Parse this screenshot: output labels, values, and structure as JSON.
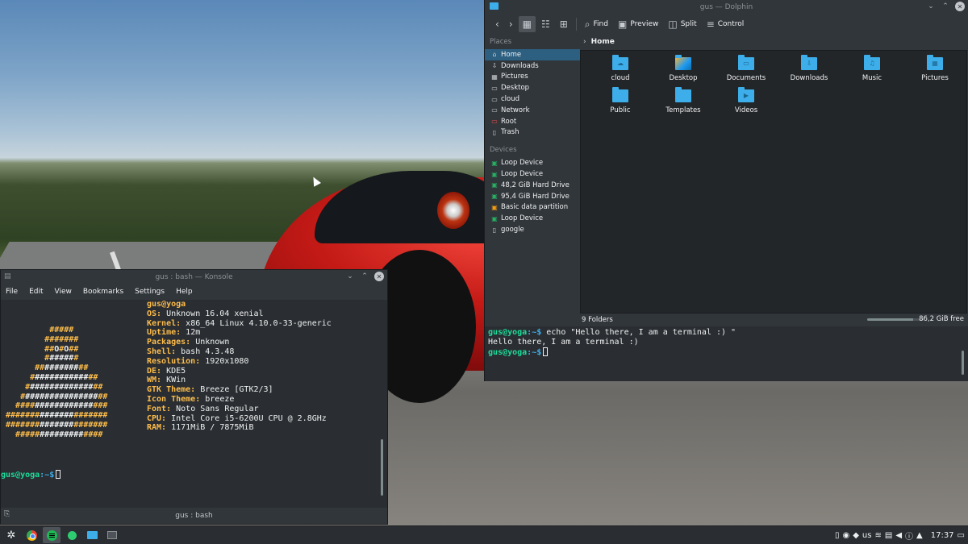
{
  "konsole": {
    "title": "gus : bash — Konsole",
    "menu": [
      "File",
      "Edit",
      "View",
      "Bookmarks",
      "Settings",
      "Help"
    ],
    "header_user": "gus@yoga",
    "info": [
      {
        "key": "OS:",
        "value": " Unknown 16.04 xenial"
      },
      {
        "key": "Kernel:",
        "value": " x86_64 Linux 4.10.0-33-generic"
      },
      {
        "key": "Uptime:",
        "value": " 12m"
      },
      {
        "key": "Packages:",
        "value": " Unknown"
      },
      {
        "key": "Shell:",
        "value": " bash 4.3.48"
      },
      {
        "key": "Resolution:",
        "value": " 1920x1080"
      },
      {
        "key": "DE:",
        "value": " KDE5"
      },
      {
        "key": "WM:",
        "value": " KWin"
      },
      {
        "key": "GTK Theme:",
        "value": " Breeze [GTK2/3]"
      },
      {
        "key": "Icon Theme:",
        "value": " breeze"
      },
      {
        "key": "Font:",
        "value": " Noto Sans Regular"
      },
      {
        "key": "CPU:",
        "value": " Intel Core i5-6200U CPU @ 2.8GHz"
      },
      {
        "key": "RAM:",
        "value": " 1171MiB / 7875MiB"
      }
    ],
    "prompt_user": "gus@yoga",
    "prompt_path": ":~$",
    "tab_label": "gus : bash"
  },
  "dolphin": {
    "title": "gus — Dolphin",
    "toolbar": {
      "find": "Find",
      "preview": "Preview",
      "split": "Split",
      "control": "Control"
    },
    "places_title": "Places",
    "places": [
      {
        "label": "Home",
        "icon": "home-icon",
        "glyph": "⌂"
      },
      {
        "label": "Downloads",
        "icon": "downloads-icon",
        "glyph": "▭"
      },
      {
        "label": "Pictures",
        "icon": "pictures-icon",
        "glyph": "▭"
      },
      {
        "label": "Desktop",
        "icon": "desktop-icon",
        "glyph": "▭"
      },
      {
        "label": "cloud",
        "icon": "cloud-folder-icon",
        "glyph": "▭"
      },
      {
        "label": "Network",
        "icon": "network-icon",
        "glyph": "▭"
      },
      {
        "label": "Root",
        "icon": "root-folder-icon",
        "glyph": "▭"
      },
      {
        "label": "Trash",
        "icon": "trash-icon",
        "glyph": "▭"
      }
    ],
    "devices_title": "Devices",
    "devices": [
      {
        "label": "Loop Device",
        "icon": "drive-icon"
      },
      {
        "label": "Loop Device",
        "icon": "drive-icon"
      },
      {
        "label": "48,2 GiB Hard Drive",
        "icon": "hard-drive-icon"
      },
      {
        "label": "95,4 GiB Hard Drive",
        "icon": "hard-drive-icon"
      },
      {
        "label": "Basic data partition",
        "icon": "partition-icon"
      },
      {
        "label": "Loop Device",
        "icon": "drive-icon"
      },
      {
        "label": "google",
        "icon": "phone-icon"
      }
    ],
    "breadcrumb": "Home",
    "files": [
      {
        "label": "cloud",
        "emblem": "☁"
      },
      {
        "label": "Desktop",
        "emblem": ""
      },
      {
        "label": "Documents",
        "emblem": "▭"
      },
      {
        "label": "Downloads",
        "emblem": "⇩"
      },
      {
        "label": "Music",
        "emblem": "♫"
      },
      {
        "label": "Pictures",
        "emblem": "▦"
      },
      {
        "label": "Public",
        "emblem": ""
      },
      {
        "label": "Templates",
        "emblem": ""
      },
      {
        "label": "Videos",
        "emblem": "▶"
      }
    ],
    "status_count": "9 Folders",
    "free_space": "86,2 GiB free",
    "free_fraction": 0.82,
    "terminal": {
      "user": "gus@yoga",
      "path": ":~$",
      "command": " echo \"Hello there, I am a terminal :) \"",
      "output": "Hello there, I am a terminal :)"
    }
  },
  "taskbar": {
    "keyboard_layout": "us",
    "clock": "17:37"
  },
  "colors": {
    "accent": "#3daee9",
    "user_green": "#1cdc9a",
    "logo_orange": "#fdbc4b",
    "window_bg": "#31363b",
    "view_bg": "#232629"
  }
}
